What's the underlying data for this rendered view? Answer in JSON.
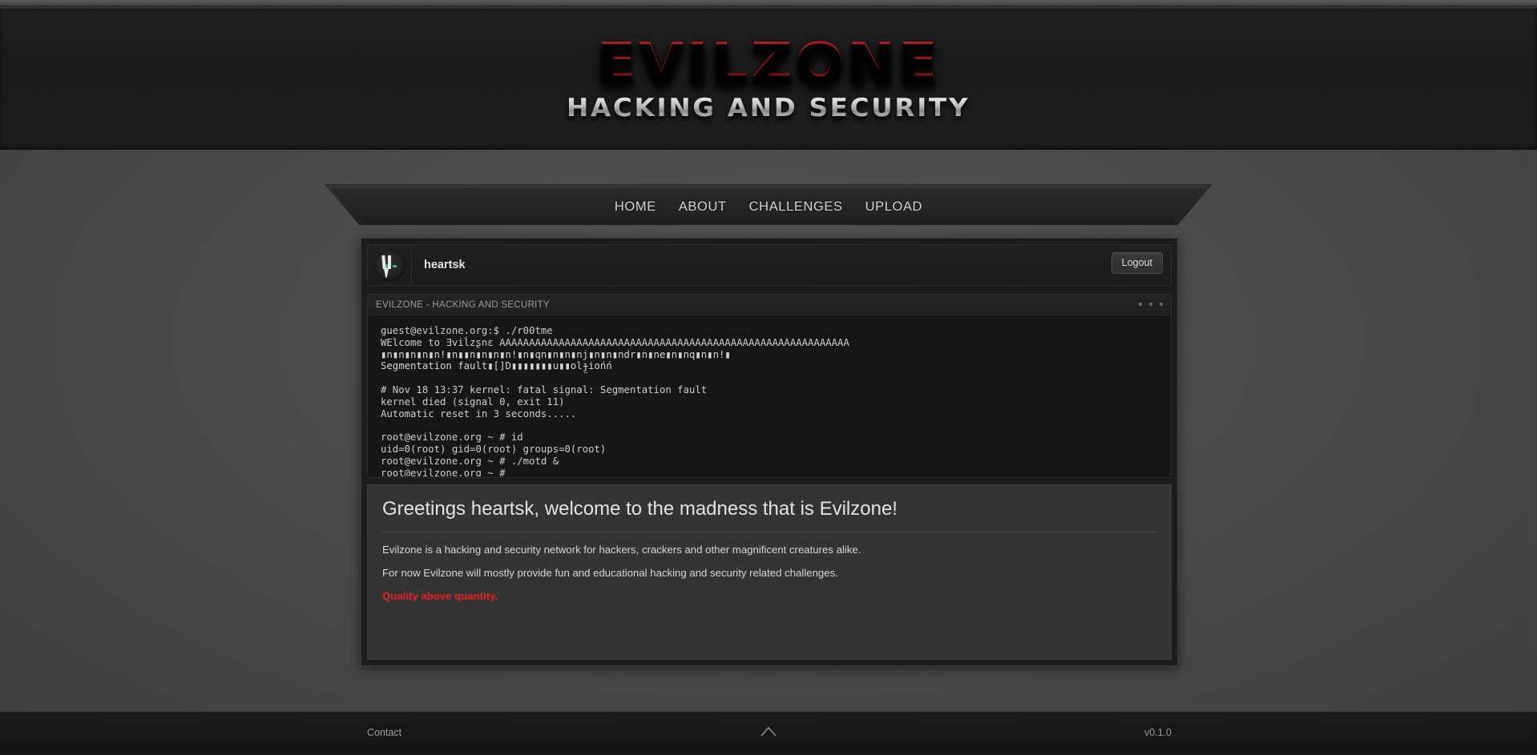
{
  "site": {
    "logo_main": "EVILZONE",
    "logo_sub": "HACKING AND SECURITY",
    "brand_red": "#c2151b",
    "accent_red": "#e8201f"
  },
  "nav": {
    "items": [
      {
        "label": "HOME"
      },
      {
        "label": "ABOUT"
      },
      {
        "label": "CHALLENGES"
      },
      {
        "label": "UPLOAD"
      }
    ]
  },
  "userbar": {
    "avatar_icon": "trident-avatar-icon",
    "username": "heartsk",
    "logout_label": "Logout"
  },
  "terminal": {
    "title": "EVILZONE - HACKING AND SECURITY",
    "controls": [
      "minimize-square",
      "maximize-square",
      "close-square"
    ],
    "lines": [
      "guest@evilzone.org:$ ./r00tme",
      "WElcome to Ǝviĺzʂnɛ AAAAAAAAAAAAAAAAAAAAAAAAAAAAAAAAAAAAAAAAAAAAAAAAAAAAAAAAAAA",
      "▮n▮n▮n▮n▮n!▮n▮▮n▮n▮n▮n!▮n▮qn▮n▮n▮nj▮n▮n▮ndr▮n▮ne▮n▮nq▮n▮n!▮",
      "Segmentation fault▮[]D▮▮▮▮▮▮▮u▮▮olɟ̤iońń",
      "",
      "# Nov 18 13:37 kernel: fatal signal: Segmentation fault",
      "kernel died (signal 0, exit 11)",
      "Automatic reset in 3 seconds.....",
      "",
      "root@evilzone.org ~ # id",
      "uid=0(root) gid=0(root) groups=0(root)",
      "root@evilzone.org ~ # ./motd &",
      "root@evilzone.org ~ #"
    ]
  },
  "content": {
    "greeting": "Greetings heartsk, welcome to the madness that is Evilzone!",
    "paragraph_1": "Evilzone is a hacking and security network for hackers, crackers and other magnificent creatures alike.",
    "paragraph_2": "For now Evilzone will mostly provide fun and educational hacking and security related challenges.",
    "paragraph_3": "Quality above quantity."
  },
  "footer": {
    "contact_label": "Contact",
    "version": "v0.1.0",
    "scroll_top_icon": "chevron-up-icon"
  }
}
